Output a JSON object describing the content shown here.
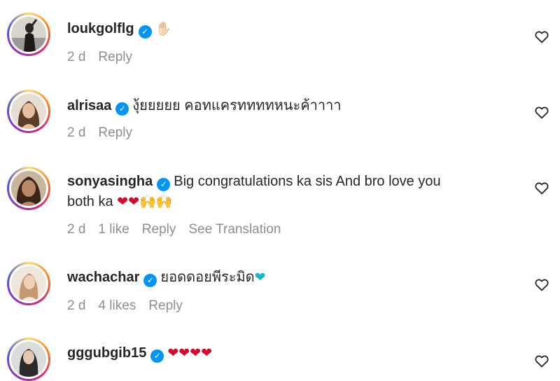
{
  "comments": [
    {
      "username": "loukgolflg",
      "text": "",
      "emoji": "✋🏻",
      "time": "2 d",
      "likes": "",
      "reply": "Reply",
      "translate": ""
    },
    {
      "username": "alrisaa",
      "text": "งุ้ยยยยย คอทแครททททหนะค้าาาา",
      "emoji": "",
      "time": "2 d",
      "likes": "",
      "reply": "Reply",
      "translate": ""
    },
    {
      "username": "sonyasingha",
      "text": "Big congratulations ka sis And bro love you",
      "text2": "both ka",
      "emoji": "❤❤🙌🙌",
      "time": "2 d",
      "likes": "1 like",
      "reply": "Reply",
      "translate": "See Translation"
    },
    {
      "username": "wachachar",
      "text": "ยอดดอยพีระมิด",
      "emoji": "❤",
      "time": "2 d",
      "likes": "4 likes",
      "reply": "Reply",
      "translate": ""
    },
    {
      "username": "gggubgib15",
      "text": "",
      "emoji": "❤❤❤❤",
      "time": "",
      "likes": "",
      "reply": "",
      "translate": ""
    }
  ],
  "icons": {
    "verified": "verified-badge-icon",
    "heart": "heart-outline-icon"
  },
  "colors": {
    "verified": "#0095f6",
    "meta": "#8e8e8e",
    "text": "#262626"
  }
}
